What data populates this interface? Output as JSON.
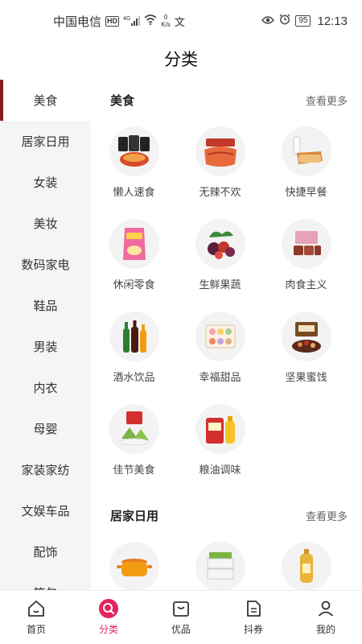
{
  "status_bar": {
    "carrier": "中国电信",
    "hd": "HD",
    "signal": "4G",
    "net_speed_value": "0",
    "net_speed_unit": "K/s",
    "battery": "95",
    "time": "12:13"
  },
  "page": {
    "title": "分类"
  },
  "sidebar": {
    "items": [
      {
        "label": "美食"
      },
      {
        "label": "居家日用"
      },
      {
        "label": "女装"
      },
      {
        "label": "美妆"
      },
      {
        "label": "数码家电"
      },
      {
        "label": "鞋品"
      },
      {
        "label": "男装"
      },
      {
        "label": "内衣"
      },
      {
        "label": "母婴"
      },
      {
        "label": "家装家纺"
      },
      {
        "label": "文娱车品"
      },
      {
        "label": "配饰"
      },
      {
        "label": "箱包"
      }
    ],
    "active_index": 0
  },
  "sections": [
    {
      "title": "美食",
      "more": "查看更多",
      "items": [
        {
          "label": "懒人速食",
          "icon": "instant-noodles-icon"
        },
        {
          "label": "无辣不欢",
          "icon": "spicy-snack-icon"
        },
        {
          "label": "快捷早餐",
          "icon": "bread-milk-icon"
        },
        {
          "label": "休闲零食",
          "icon": "chips-bag-icon"
        },
        {
          "label": "生鲜果蔬",
          "icon": "fresh-fruit-icon"
        },
        {
          "label": "肉食主义",
          "icon": "meat-box-icon"
        },
        {
          "label": "酒水饮品",
          "icon": "drink-bottles-icon"
        },
        {
          "label": "幸福甜品",
          "icon": "macaron-box-icon"
        },
        {
          "label": "坚果蜜饯",
          "icon": "nuts-gift-box-icon"
        },
        {
          "label": "佳节美食",
          "icon": "zongzi-icon"
        },
        {
          "label": "粮油调味",
          "icon": "rice-oil-icon"
        }
      ]
    },
    {
      "title": "居家日用",
      "more": "查看更多",
      "items": [
        {
          "label": "",
          "icon": "cooking-pot-icon"
        },
        {
          "label": "",
          "icon": "storage-drawer-icon"
        },
        {
          "label": "",
          "icon": "shampoo-bottle-icon"
        }
      ]
    }
  ],
  "bottom_nav": [
    {
      "label": "首页",
      "icon": "home-icon"
    },
    {
      "label": "分类",
      "icon": "search-category-icon"
    },
    {
      "label": "优品",
      "icon": "premium-bag-icon"
    },
    {
      "label": "抖券",
      "icon": "coupon-icon"
    },
    {
      "label": "我的",
      "icon": "profile-icon"
    }
  ],
  "colors": {
    "accent": "#e0245e",
    "sidebar_indicator": "#8a1c1c",
    "sidebar_bg": "#f5f5f5"
  }
}
